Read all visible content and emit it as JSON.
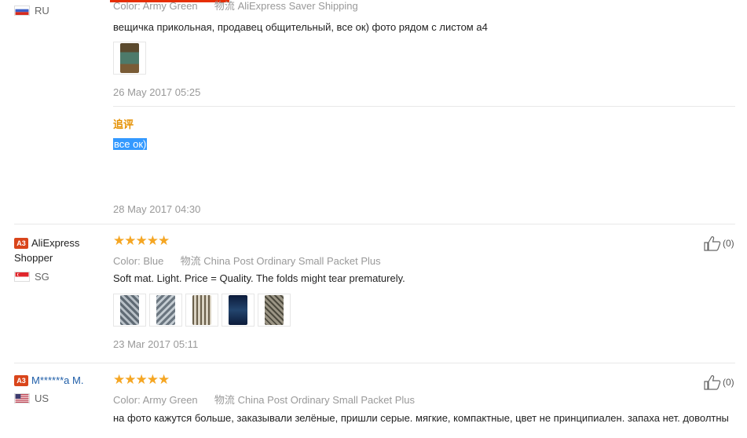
{
  "review1": {
    "country": "RU",
    "color_label": "Color:",
    "color_value": "Army Green",
    "shipping_label": "物流",
    "shipping_value": "AliExpress Saver Shipping",
    "text": "вещичка прикольная, продавец общительный, все ок) фото рядом с листом а4",
    "date": "26 May 2017 05:25",
    "followup_title": "追评",
    "followup_text": "все ок)",
    "followup_date": "28 May 2017 04:30"
  },
  "review2": {
    "badge": "A3",
    "username": "AliExpress Shopper",
    "country": "SG",
    "stars": "★★★★★",
    "color_label": "Color:",
    "color_value": "Blue",
    "shipping_label": "物流",
    "shipping_value": "China Post Ordinary Small Packet Plus",
    "text": "Soft mat. Light. Price = Quality. The folds might tear prematurely.",
    "date": "23 Mar 2017 05:11",
    "likes": "(0)"
  },
  "review3": {
    "badge": "A3",
    "username": "M******a M.",
    "country": "US",
    "stars": "★★★★★",
    "color_label": "Color:",
    "color_value": "Army Green",
    "shipping_label": "物流",
    "shipping_value": "China Post Ordinary Small Packet Plus",
    "text": "на фото кажутся больше, заказывали зелёные, пришли серые. мягкие, компактные, цвет не принципиален. запаха нет. доволтны",
    "likes": "(0)"
  },
  "colors": {
    "accent": "#e62e04",
    "star": "#f5a623",
    "followup": "#e59000",
    "link": "#1f5ea8",
    "badge": "#d9451b"
  }
}
